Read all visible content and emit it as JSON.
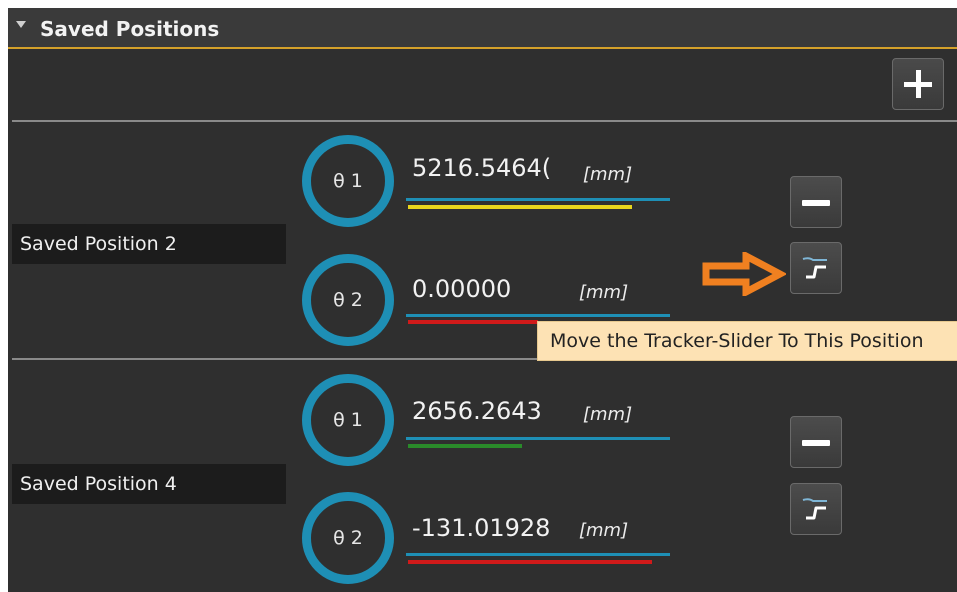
{
  "panel": {
    "title": "Saved Positions"
  },
  "positions": [
    {
      "name": "Saved Position 2",
      "axes": [
        {
          "label": "θ 1",
          "value": "5216.5464(",
          "unit": "[mm]",
          "indicator_color": "#e8d51c"
        },
        {
          "label": "θ 2",
          "value": "0.00000",
          "unit": "[mm]",
          "indicator_color": "#d01a1a"
        }
      ]
    },
    {
      "name": "Saved Position 4",
      "axes": [
        {
          "label": "θ 1",
          "value": "2656.2643",
          "unit": "[mm]",
          "indicator_color": "#2a8a2a"
        },
        {
          "label": "θ 2",
          "value": "-131.01928",
          "unit": "[mm]",
          "indicator_color": "#d01a1a"
        }
      ]
    }
  ],
  "icons": {
    "collapse": "chevron-down-icon",
    "add": "plus-icon",
    "remove": "minus-icon",
    "move": "slider-move-icon",
    "pointer": "arrow-right-icon"
  },
  "tooltip": {
    "text": "Move the Tracker-Slider To This Position"
  },
  "colors": {
    "accent_blue": "#1e8fb5",
    "header_rule": "#d4a12a",
    "pointer_orange": "#f08020",
    "tooltip_bg": "#fde2b4"
  }
}
